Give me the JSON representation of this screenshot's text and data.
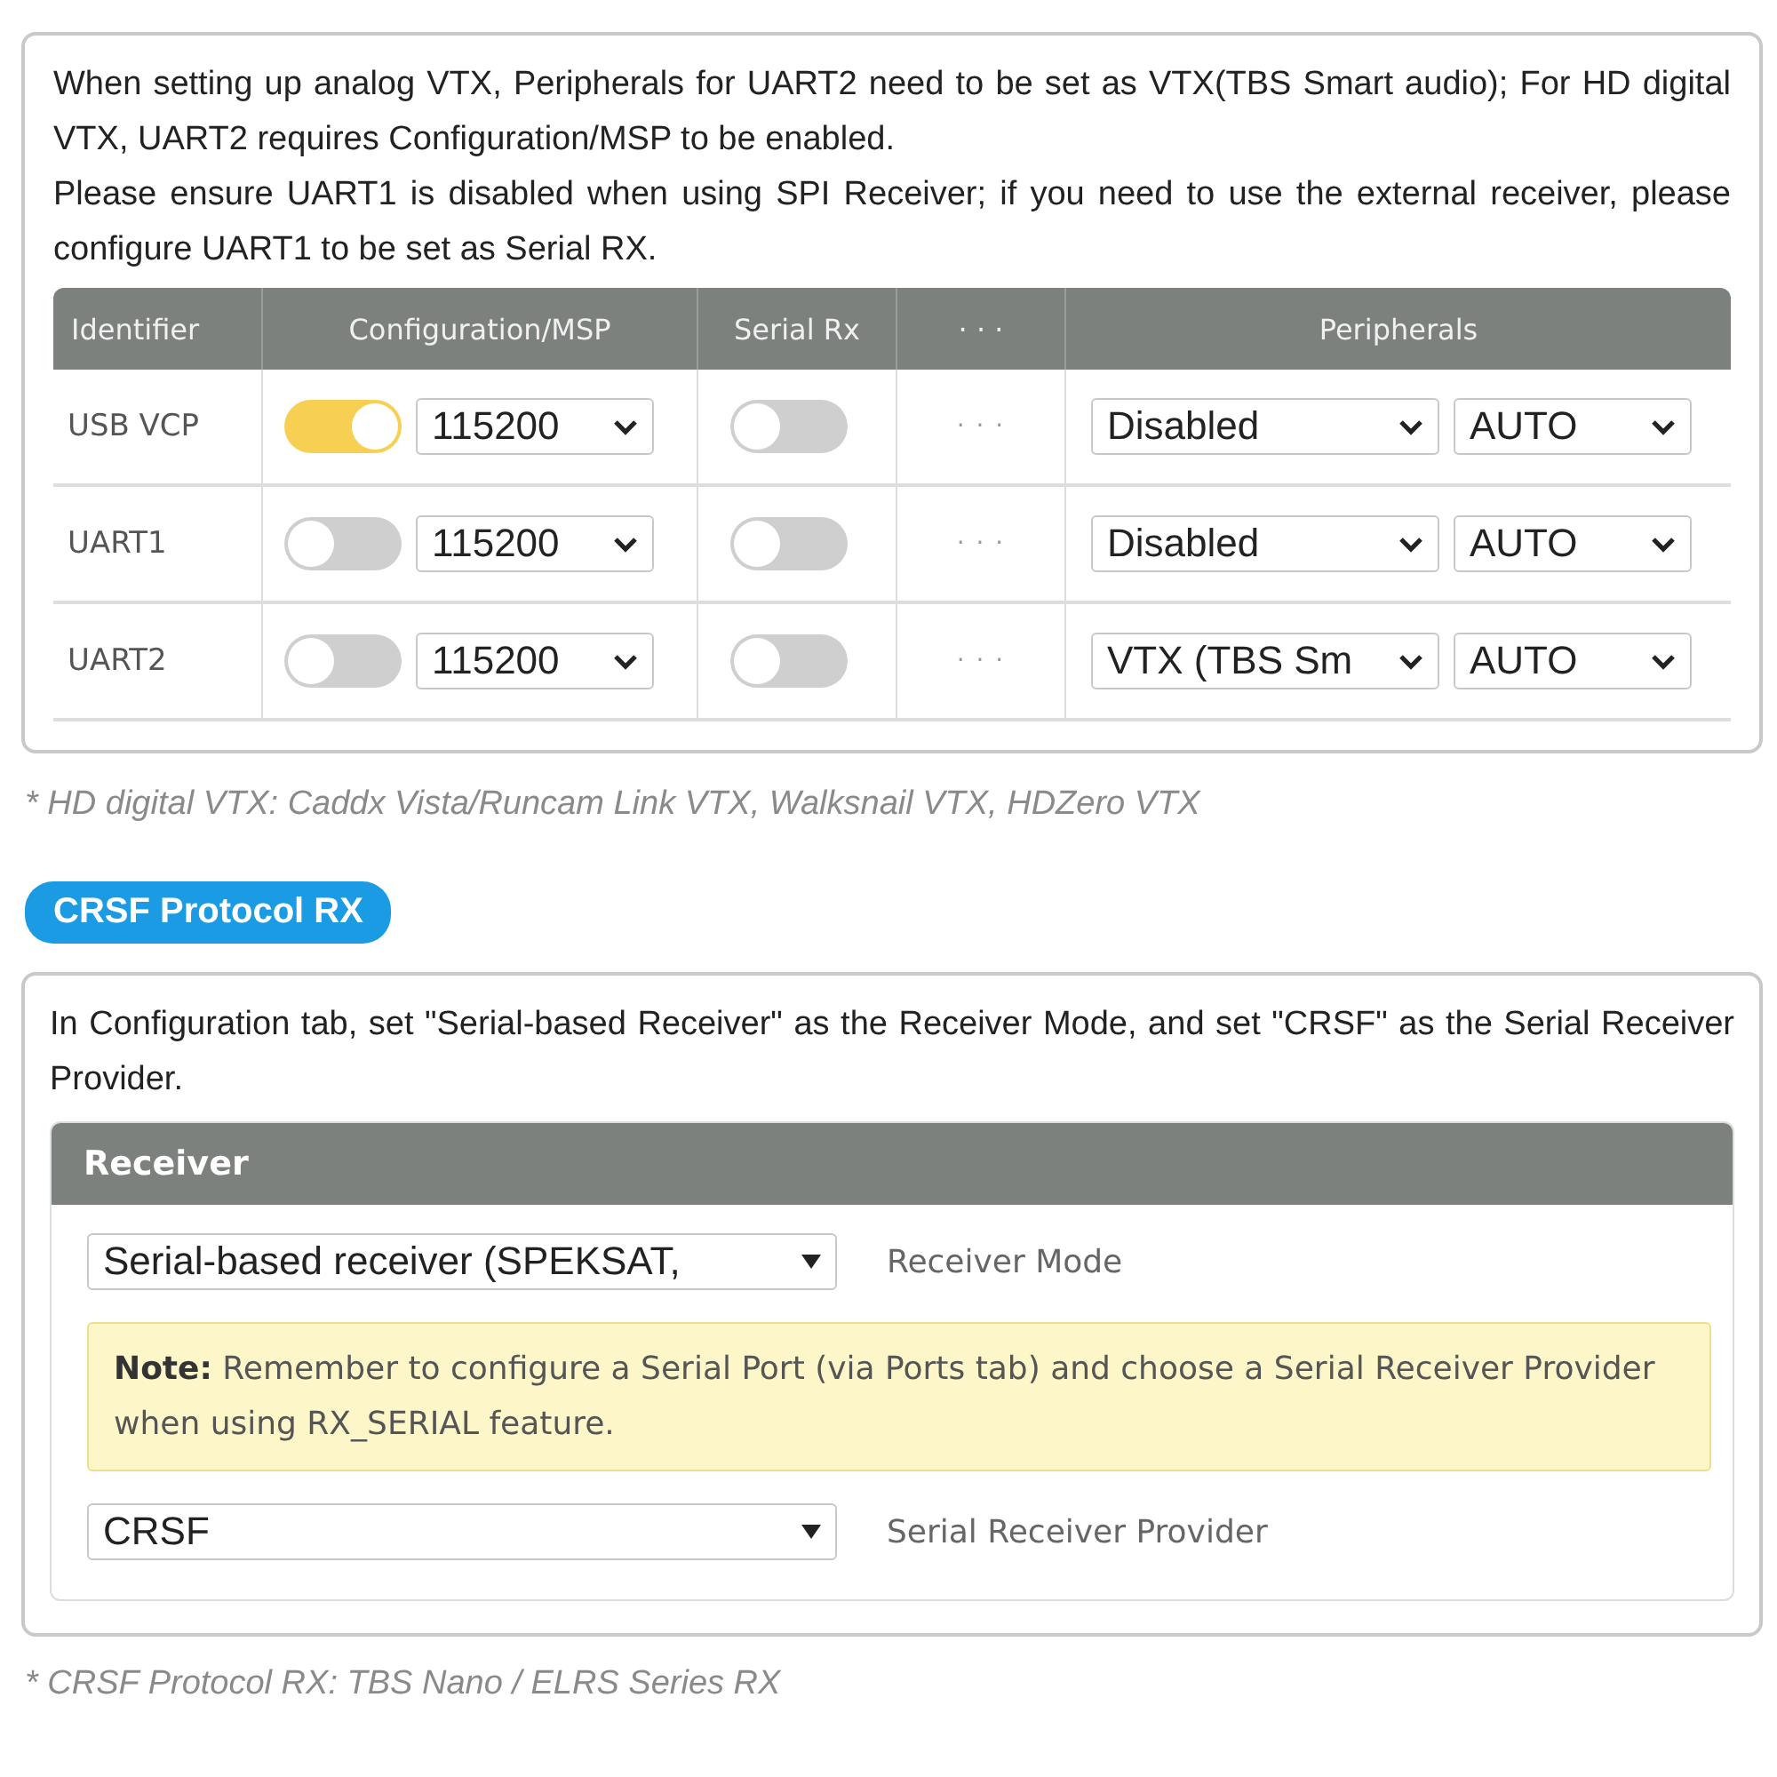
{
  "ports_note": {
    "paragraphs": [
      "When setting up analog VTX, Peripherals for UART2 need to be set as VTX(TBS Smart audio); For HD digital VTX, UART2 requires Configuration/MSP to be enabled.",
      "Please ensure UART1 is disabled when using SPI Receiver; if you need to use the external receiver, please configure UART1 to be set as Serial RX."
    ]
  },
  "ports_table": {
    "columns": [
      "Identifier",
      "Configuration/MSP",
      "Serial Rx",
      "· · ·",
      "Peripherals"
    ],
    "rows": [
      {
        "identifier": "USB VCP",
        "msp_on": true,
        "baud": "115200",
        "serial_rx_on": false,
        "column_4": "· · ·",
        "peripheral": "Disabled",
        "speed": "AUTO"
      },
      {
        "identifier": "UART1",
        "msp_on": false,
        "baud": "115200",
        "serial_rx_on": false,
        "column_4": "· · ·",
        "peripheral": "Disabled",
        "speed": "AUTO"
      },
      {
        "identifier": "UART2",
        "msp_on": false,
        "baud": "115200",
        "serial_rx_on": false,
        "column_4": "· · ·",
        "peripheral": "VTX (TBS Sm",
        "speed": "AUTO"
      }
    ]
  },
  "footnote_1": "* HD digital VTX: Caddx Vista/Runcam Link VTX, Walksnail VTX, HDZero VTX",
  "section_badge": "CRSF Protocol RX",
  "crsf_note": "In Configuration tab, set \"Serial-based Receiver\" as the Receiver Mode, and set \"CRSF\" as the Serial Receiver Provider.",
  "receiver_panel": {
    "title": "Receiver",
    "receiver_mode": {
      "value": "Serial-based receiver (SPEKSAT,",
      "label": "Receiver Mode"
    },
    "note": "**Note:** Remember to configure a Serial Port (via Ports tab) and choose a Serial Receiver Provider when using RX_SERIAL feature.",
    "provider": {
      "value": "CRSF",
      "label": "Serial Receiver Provider"
    }
  },
  "footnote_2": "* CRSF Protocol RX: TBS Nano / ELRS Series RX"
}
